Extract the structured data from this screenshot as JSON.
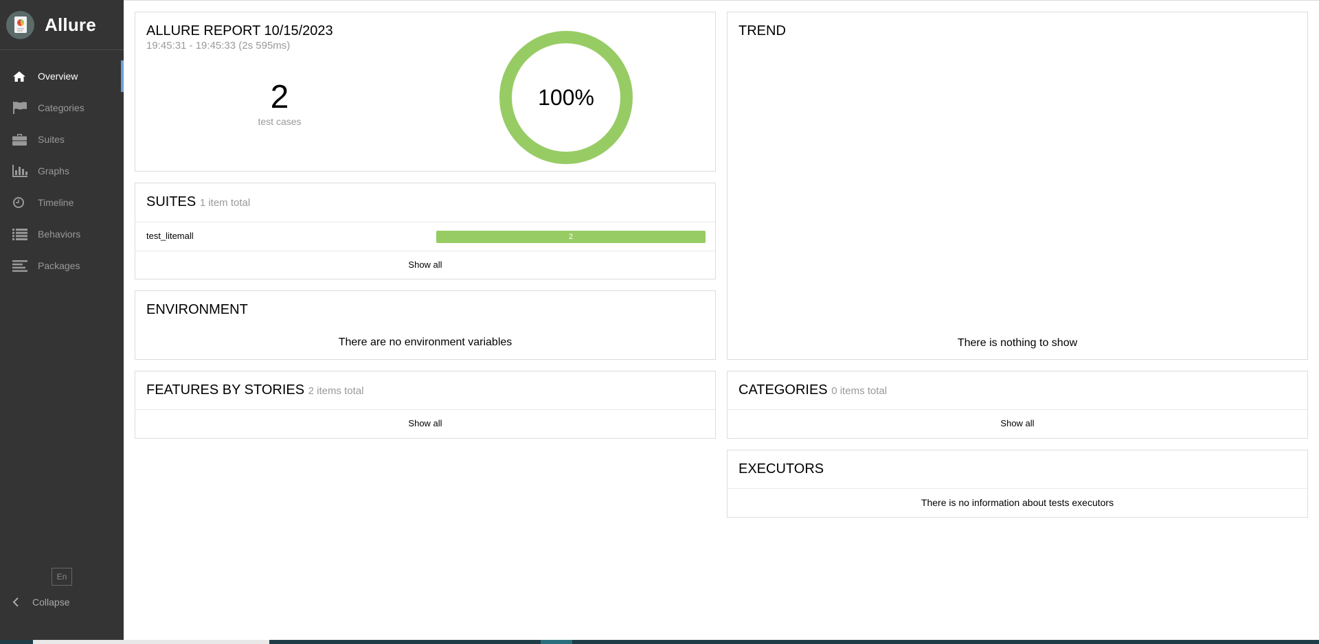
{
  "brand": {
    "name": "Allure"
  },
  "sidebar": {
    "items": [
      {
        "label": "Overview",
        "icon": "home-icon",
        "active": true
      },
      {
        "label": "Categories",
        "icon": "flag-icon",
        "active": false
      },
      {
        "label": "Suites",
        "icon": "briefcase-icon",
        "active": false
      },
      {
        "label": "Graphs",
        "icon": "bar-chart-icon",
        "active": false
      },
      {
        "label": "Timeline",
        "icon": "clock-icon",
        "active": false
      },
      {
        "label": "Behaviors",
        "icon": "list-icon",
        "active": false
      },
      {
        "label": "Packages",
        "icon": "align-left-icon",
        "active": false
      }
    ],
    "language": "En",
    "collapse_label": "Collapse"
  },
  "summary": {
    "title": "ALLURE REPORT 10/15/2023",
    "time": "19:45:31 - 19:45:33 (2s 595ms)",
    "test_cases_count": "2",
    "test_cases_label": "test cases",
    "pass_percent": "100%",
    "pass_fraction": 1.0
  },
  "suites": {
    "title": "SUITES",
    "count": "1 item total",
    "rows": [
      {
        "name": "test_litemall",
        "passed": "2"
      }
    ],
    "show_all": "Show all"
  },
  "environment": {
    "title": "ENVIRONMENT",
    "message": "There are no environment variables"
  },
  "trend": {
    "title": "TREND",
    "message": "There is nothing to show"
  },
  "features": {
    "title": "FEATURES BY STORIES",
    "count": "2 items total",
    "show_all": "Show all"
  },
  "categories": {
    "title": "CATEGORIES",
    "count": "0 items total",
    "show_all": "Show all"
  },
  "executors": {
    "title": "EXECUTORS",
    "message": "There is no information about tests executors"
  },
  "colors": {
    "passed": "#97cc64",
    "sidebar": "#343434",
    "active_marker": "#6fa0d8"
  }
}
